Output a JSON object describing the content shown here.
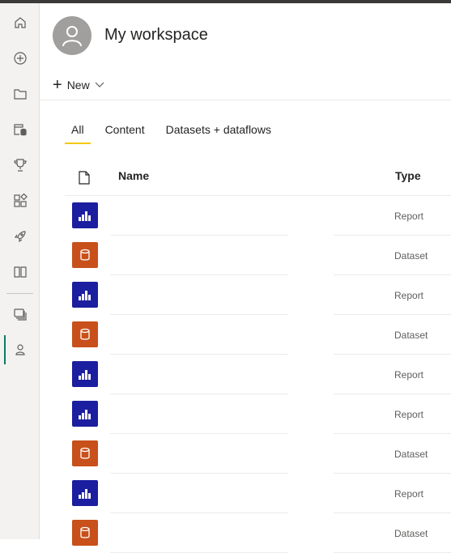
{
  "header": {
    "title": "My workspace"
  },
  "toolbar": {
    "new_label": "New"
  },
  "tabs": [
    {
      "label": "All",
      "active": true
    },
    {
      "label": "Content",
      "active": false
    },
    {
      "label": "Datasets + dataflows",
      "active": false
    }
  ],
  "table": {
    "columns": {
      "name": "Name",
      "type": "Type"
    },
    "rows": [
      {
        "type": "Report",
        "icon": "report-icon"
      },
      {
        "type": "Dataset",
        "icon": "dataset-icon"
      },
      {
        "type": "Report",
        "icon": "report-icon"
      },
      {
        "type": "Dataset",
        "icon": "dataset-icon"
      },
      {
        "type": "Report",
        "icon": "report-icon"
      },
      {
        "type": "Report",
        "icon": "report-icon"
      },
      {
        "type": "Dataset",
        "icon": "dataset-icon"
      },
      {
        "type": "Report",
        "icon": "report-icon"
      },
      {
        "type": "Dataset",
        "icon": "dataset-icon"
      }
    ]
  },
  "nav": {
    "items": [
      "home-icon",
      "create-icon",
      "browse-icon",
      "data-hub-icon",
      "goals-icon",
      "apps-icon",
      "learn-icon",
      "book-icon",
      "workspaces-icon",
      "my-workspace-icon"
    ]
  },
  "colors": {
    "report": "#1c1ea0",
    "dataset": "#c8501a",
    "tab_accent": "#f2c811",
    "active_nav": "#117865"
  }
}
